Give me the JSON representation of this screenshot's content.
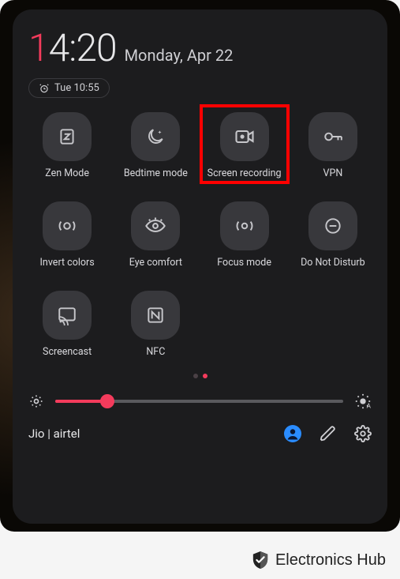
{
  "clock": {
    "hour_first": "1",
    "rest": "4:20"
  },
  "date": "Monday, Apr 22",
  "alarm": "Tue 10:55",
  "tiles": [
    {
      "id": "zen-mode",
      "label": "Zen Mode",
      "icon": "zen-icon",
      "highlighted": false
    },
    {
      "id": "bedtime-mode",
      "label": "Bedtime mode",
      "icon": "bedtime-icon",
      "highlighted": false
    },
    {
      "id": "screen-recording",
      "label": "Screen recording",
      "icon": "screen-record-icon",
      "highlighted": true
    },
    {
      "id": "vpn",
      "label": "VPN",
      "icon": "vpn-icon",
      "highlighted": false
    },
    {
      "id": "invert-colors",
      "label": "Invert colors",
      "icon": "invert-icon",
      "highlighted": false
    },
    {
      "id": "eye-comfort",
      "label": "Eye comfort",
      "icon": "eye-icon",
      "highlighted": false
    },
    {
      "id": "focus-mode",
      "label": "Focus mode",
      "icon": "focus-icon",
      "highlighted": false
    },
    {
      "id": "do-not-disturb",
      "label": "Do Not Disturb",
      "icon": "dnd-icon",
      "highlighted": false
    },
    {
      "id": "screencast",
      "label": "Screencast",
      "icon": "cast-icon",
      "highlighted": false
    },
    {
      "id": "nfc",
      "label": "NFC",
      "icon": "nfc-icon",
      "highlighted": false
    }
  ],
  "page_dots": {
    "count": 2,
    "active": 1
  },
  "brightness": {
    "percent": 18
  },
  "carrier": "Jio | airtel",
  "watermark": "Electronics Hub",
  "colors": {
    "accent": "#f43b5c"
  }
}
